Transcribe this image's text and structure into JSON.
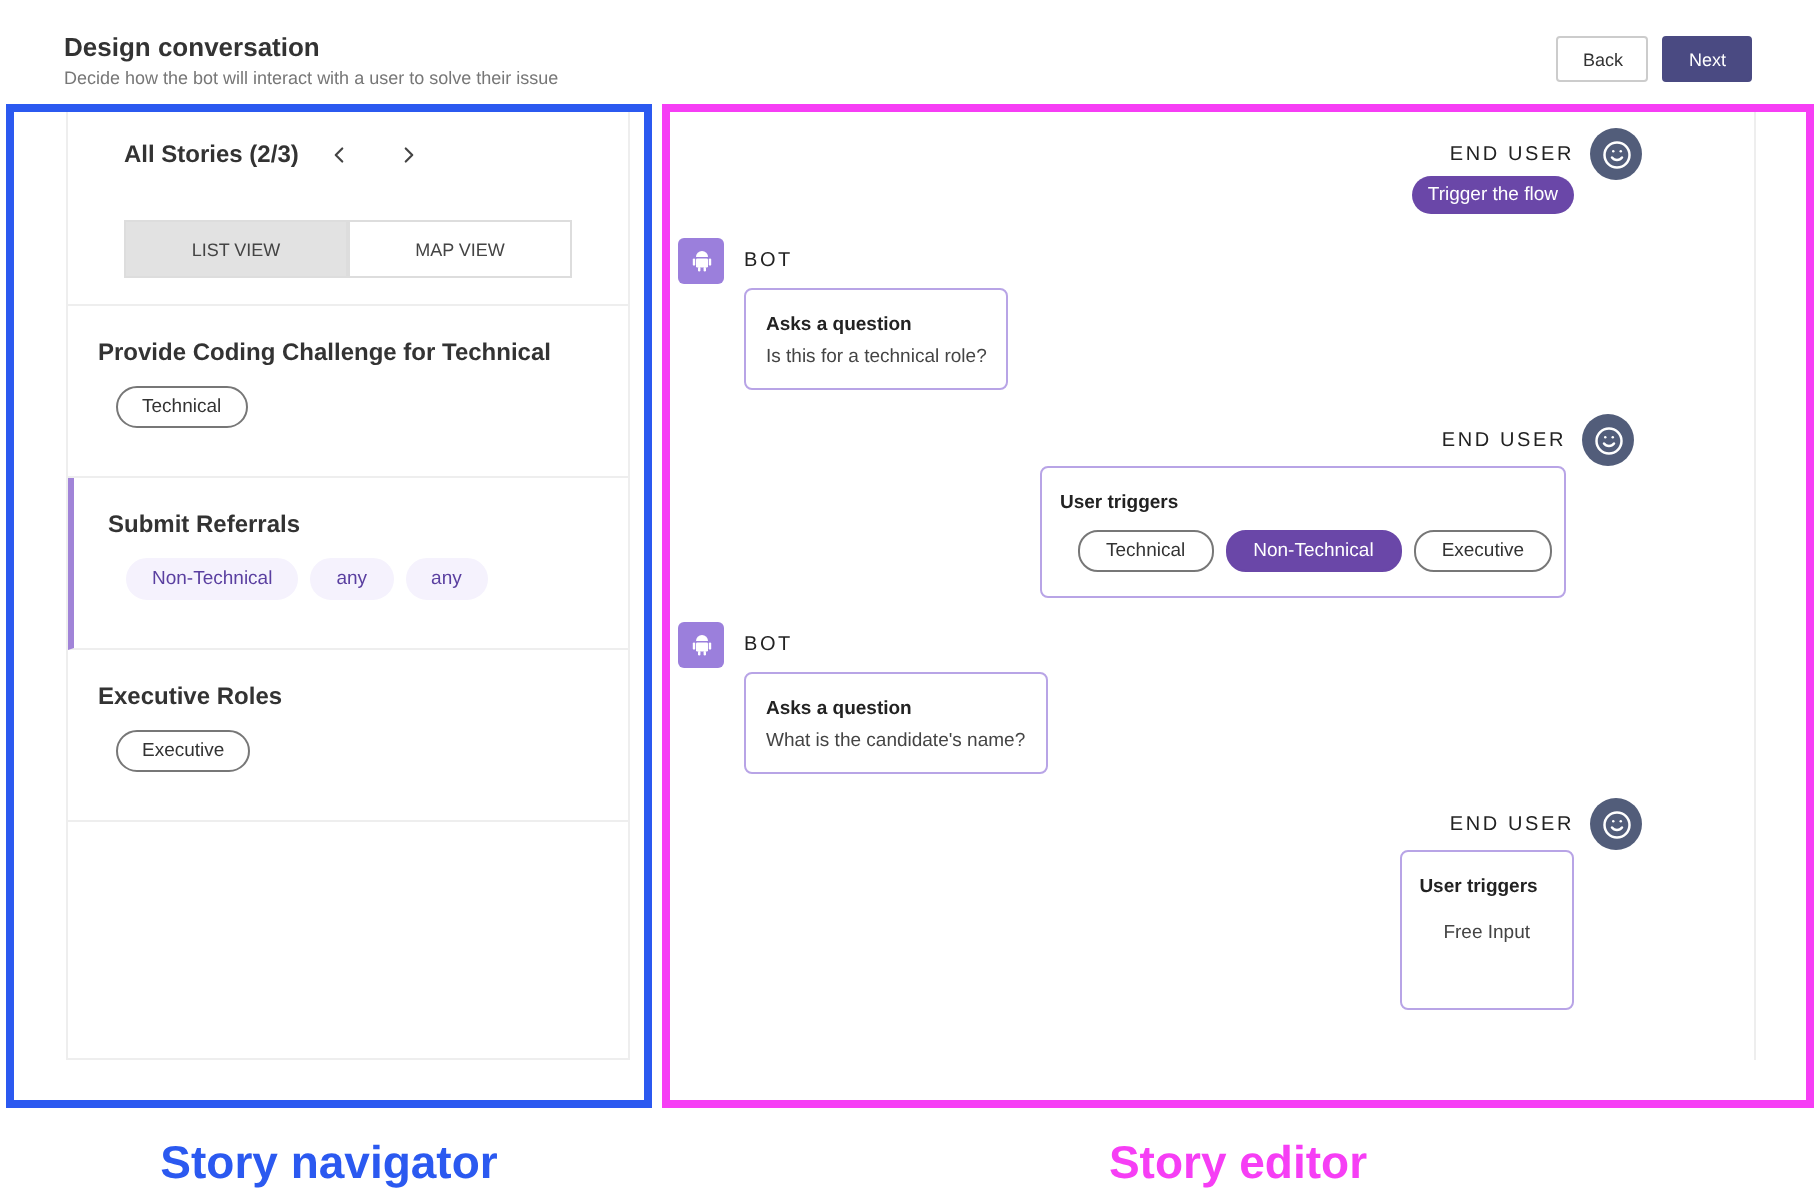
{
  "header": {
    "title": "Design conversation",
    "subtitle": "Decide how the bot will interact with a user to solve their issue",
    "buttons": [
      {
        "label": "Back",
        "kind": "secondary"
      },
      {
        "label": "Next",
        "kind": "primary"
      }
    ]
  },
  "navigator": {
    "title": "All Stories (2/3)",
    "views": [
      {
        "label": "LIST VIEW",
        "selected": true
      },
      {
        "label": "MAP VIEW",
        "selected": false
      }
    ],
    "stories": [
      {
        "title": "Provide Coding Challenge for Technical",
        "selected": false,
        "tags": [
          {
            "label": "Technical",
            "kind": "outline"
          }
        ]
      },
      {
        "title": "Submit Referrals",
        "selected": true,
        "tags": [
          {
            "label": "Non-Technical",
            "kind": "soft"
          },
          {
            "label": "any",
            "kind": "soft"
          },
          {
            "label": "any",
            "kind": "soft"
          }
        ]
      },
      {
        "title": "Executive Roles",
        "selected": false,
        "tags": [
          {
            "label": "Executive",
            "kind": "outline"
          }
        ]
      }
    ]
  },
  "editor": {
    "messages": [
      {
        "kind": "trigger",
        "speaker": "END USER",
        "pill": "Trigger the flow"
      },
      {
        "kind": "bot",
        "speaker": "BOT",
        "heading": "Asks a question",
        "text": "Is this for a technical role?"
      },
      {
        "kind": "choice",
        "speaker": "END USER",
        "heading": "User triggers",
        "options": [
          {
            "label": "Technical",
            "selected": false
          },
          {
            "label": "Non-Technical",
            "selected": true
          },
          {
            "label": "Executive",
            "selected": false
          }
        ]
      },
      {
        "kind": "bot",
        "speaker": "BOT",
        "heading": "Asks a question",
        "text": "What is the candidate's name?"
      },
      {
        "kind": "free",
        "speaker": "END USER",
        "heading": "User triggers",
        "text": "Free Input"
      }
    ]
  },
  "annotations": [
    {
      "label": "Story navigator",
      "color": "#2b59f0"
    },
    {
      "label": "Story editor",
      "color": "#f63ef5"
    }
  ]
}
